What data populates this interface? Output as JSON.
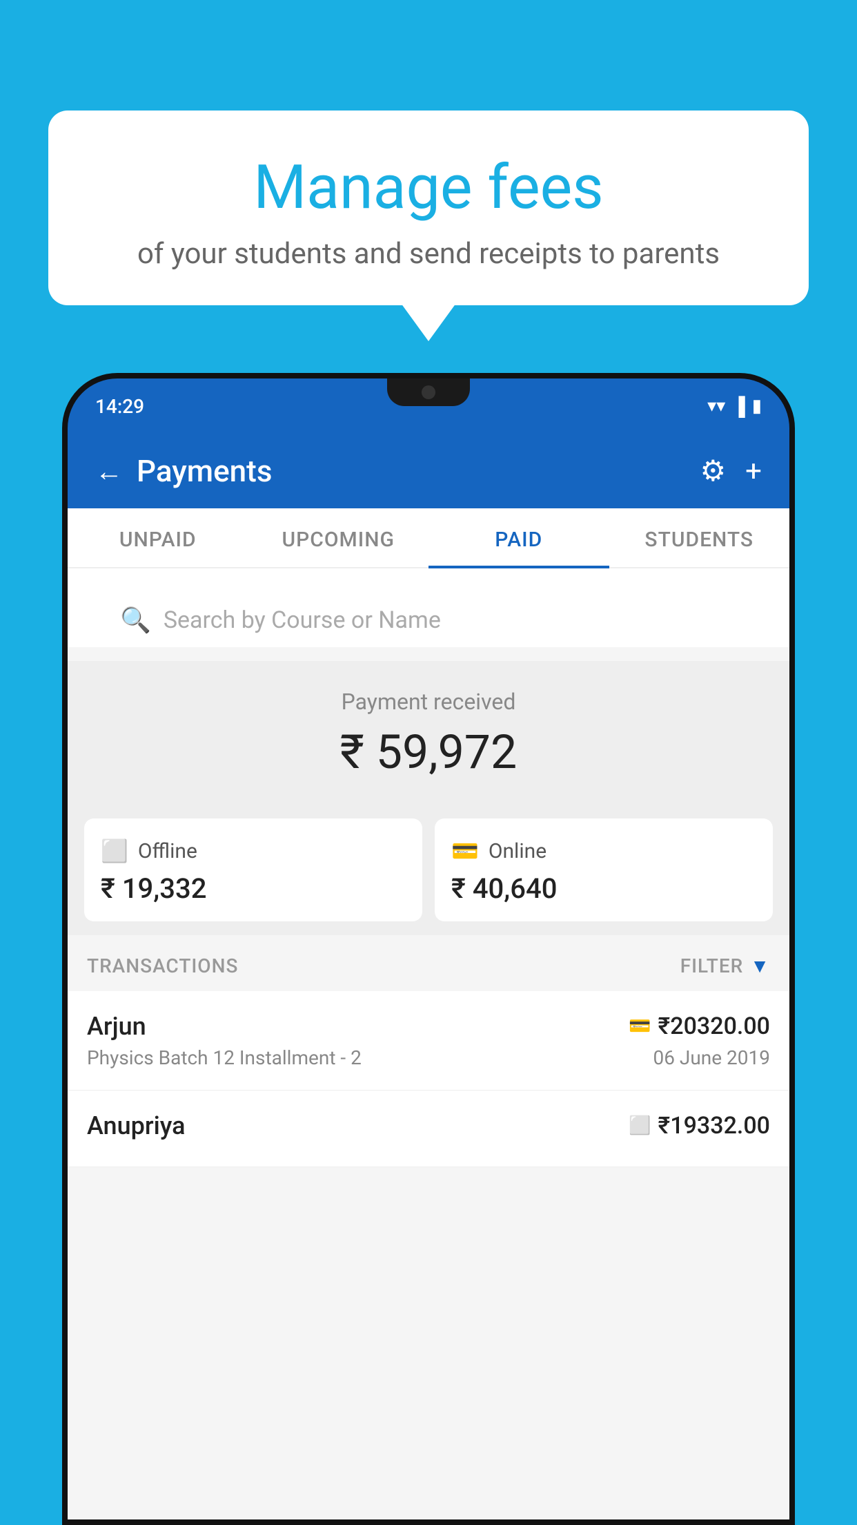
{
  "background_color": "#1AAFE3",
  "bubble": {
    "title": "Manage fees",
    "subtitle": "of your students and send receipts to parents"
  },
  "status_bar": {
    "time": "14:29",
    "wifi_icon": "wifi",
    "signal_icon": "signal",
    "battery_icon": "battery"
  },
  "app_header": {
    "title": "Payments",
    "back_label": "←",
    "settings_label": "⚙",
    "add_label": "+"
  },
  "tabs": [
    {
      "label": "UNPAID",
      "active": false
    },
    {
      "label": "UPCOMING",
      "active": false
    },
    {
      "label": "PAID",
      "active": true
    },
    {
      "label": "STUDENTS",
      "active": false
    }
  ],
  "search": {
    "placeholder": "Search by Course or Name"
  },
  "payment_summary": {
    "label": "Payment received",
    "amount": "₹ 59,972"
  },
  "payment_cards": [
    {
      "icon": "offline",
      "label": "Offline",
      "amount": "₹ 19,332"
    },
    {
      "icon": "online",
      "label": "Online",
      "amount": "₹ 40,640"
    }
  ],
  "transactions_section": {
    "label": "TRANSACTIONS",
    "filter_label": "FILTER"
  },
  "transactions": [
    {
      "name": "Arjun",
      "type_icon": "card",
      "amount": "₹20320.00",
      "description": "Physics Batch 12 Installment - 2",
      "date": "06 June 2019"
    },
    {
      "name": "Anupriya",
      "type_icon": "offline",
      "amount": "₹19332.00",
      "description": "",
      "date": ""
    }
  ]
}
